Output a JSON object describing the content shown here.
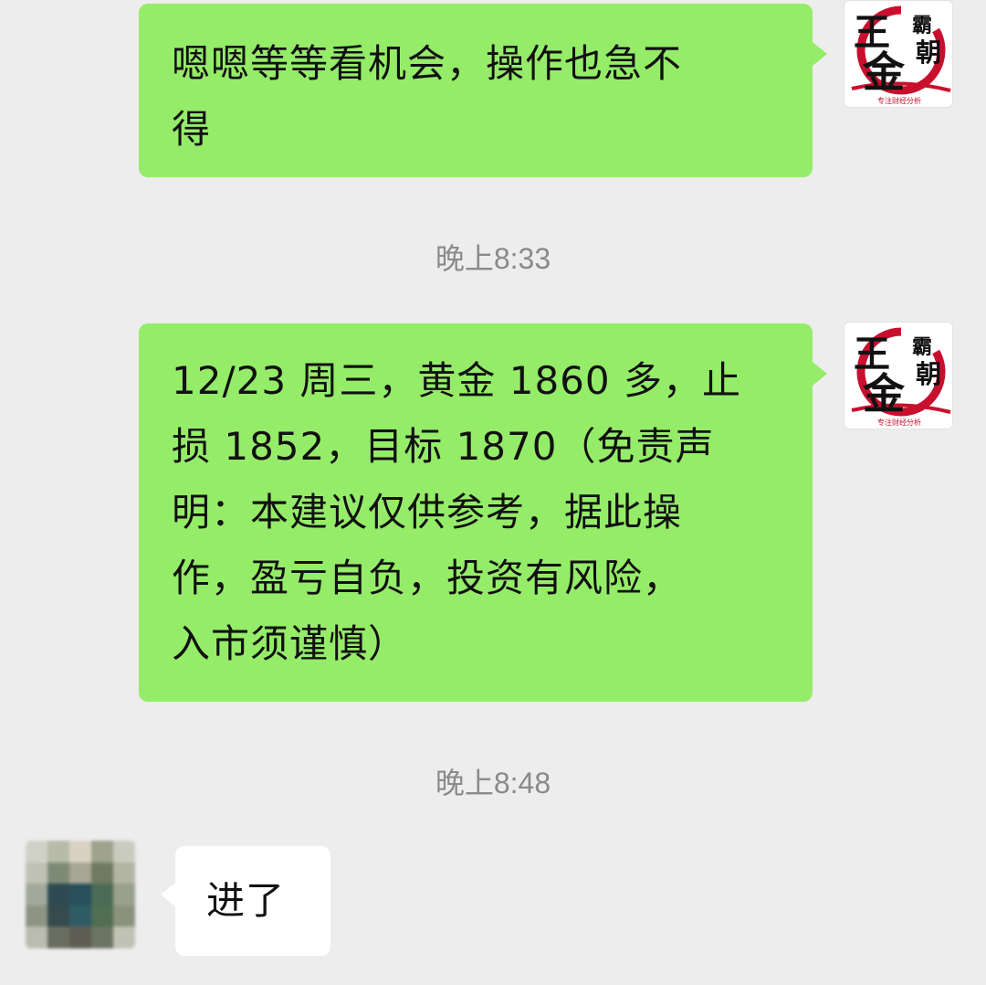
{
  "messages": [
    {
      "id": "msg1",
      "direction": "sent",
      "text": "嗯嗯等等看机会，操作也急不\n得"
    },
    {
      "id": "msg2",
      "direction": "sent",
      "text": "12/23 周三，黄金 1860 多，止\n损 1852，目标 1870（免责声\n明：本建议仅供参考，据此操\n作，盈亏自负，投资有风险，\n入市须谨慎）"
    },
    {
      "id": "msg3",
      "direction": "received",
      "text": "进了"
    }
  ],
  "timestamps": [
    "晚上8:33",
    "晚上8:48"
  ],
  "avatar_sender": {
    "icon": "brand-logo-avatar",
    "logo_text": {
      "large_1": "王",
      "large_2": "金",
      "small_1": "霸",
      "small_2": "朝",
      "caption": "专注财经分析"
    }
  },
  "avatar_receiver": {
    "icon": "pixelated-avatar"
  },
  "colors": {
    "background": "#ededed",
    "sent_bubble": "#95ec69",
    "received_bubble": "#ffffff",
    "timestamp_text": "#8a8a8a",
    "logo_red": "#c8102e"
  }
}
